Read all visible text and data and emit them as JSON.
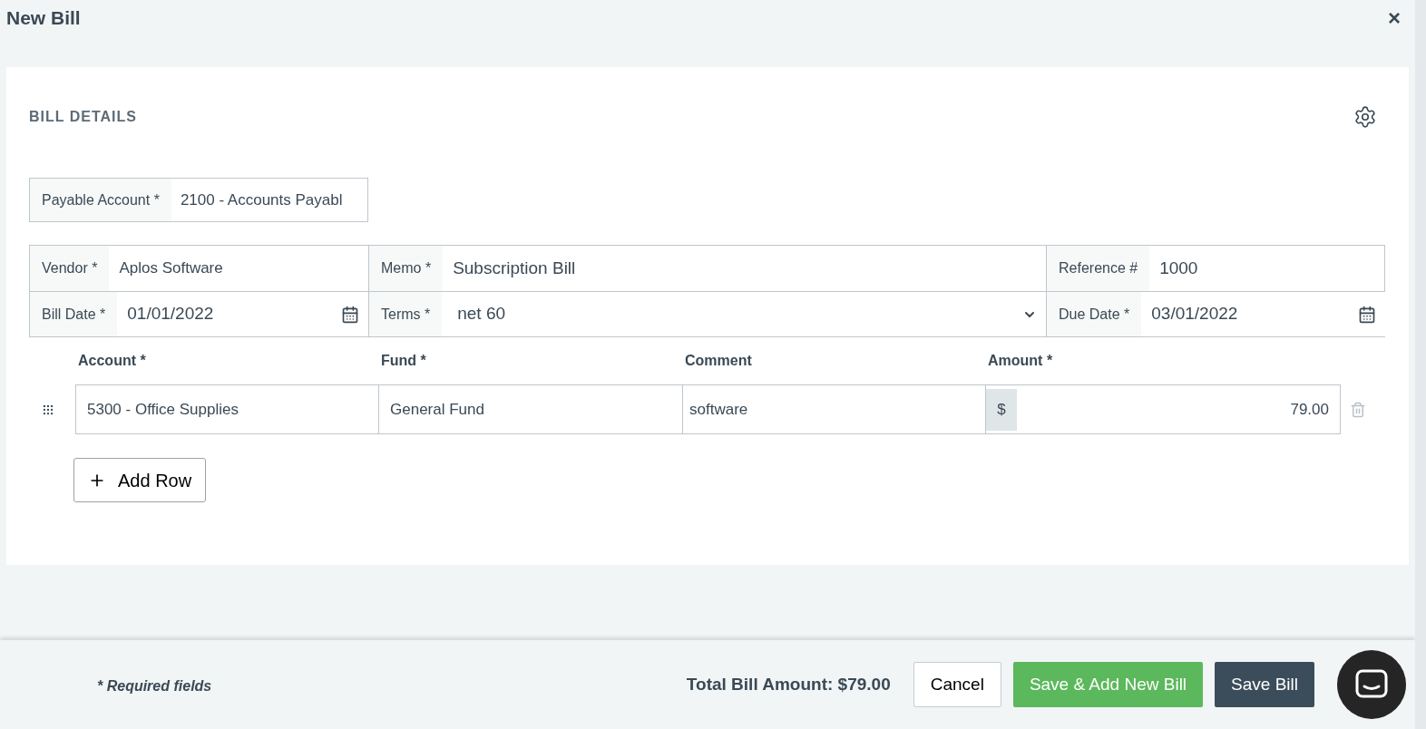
{
  "dialog": {
    "title": "New Bill",
    "close": "×"
  },
  "section": {
    "title": "BILL DETAILS"
  },
  "payable": {
    "label": "Payable Account *",
    "value": "2100 - Accounts Payabl"
  },
  "fields": [
    {
      "label": "Vendor *",
      "value": "Aplos Software",
      "kind": "text"
    },
    {
      "label": "Memo *",
      "value": "Subscription Bill",
      "kind": "text"
    },
    {
      "label": "Reference #",
      "value": "1000",
      "kind": "text"
    },
    {
      "label": "Bill Date *",
      "value": "01/01/2022",
      "kind": "date"
    },
    {
      "label": "Terms *",
      "value": "net 60",
      "kind": "select"
    },
    {
      "label": "Due Date *",
      "value": "03/01/2022",
      "kind": "date"
    }
  ],
  "lines": {
    "columns": [
      "Account *",
      "Fund *",
      "Comment",
      "Amount *"
    ],
    "rows": [
      {
        "account": "5300 - Office Supplies",
        "fund": "General Fund",
        "comment": "software",
        "currency": "$",
        "amount": "79.00"
      }
    ],
    "add_button": "Add Row"
  },
  "footer": {
    "note": "* Required fields",
    "total": "Total Bill Amount: $79.00",
    "buttons": [
      {
        "label": "Cancel",
        "kind": "secondary"
      },
      {
        "label": "Save & Add New Bill",
        "kind": "success"
      },
      {
        "label": "Save Bill",
        "kind": "primary"
      }
    ]
  }
}
